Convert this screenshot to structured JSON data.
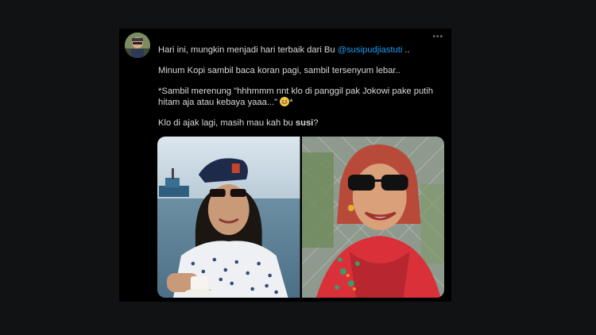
{
  "tweet": {
    "line1_prefix": "Hari ini, mungkin menjadi hari terbaik dari Bu ",
    "line1_mention": "@susipudjiastuti",
    "line1_suffix": " ..",
    "line2": "Minum Kopi sambil baca koran pagi,  sambil tersenyum lebar..",
    "line3": "*Sambil merenung \"hhhmmm nnt klo di panggil pak Jokowi pake putih hitam aja atau kebaya yaaa...\" ",
    "line3_end": "*",
    "line4_prefix": "Klo di ajak lagi, masih mau kah bu ",
    "line4_bold": "susi",
    "line4_suffix": "?",
    "more_icon": "•••"
  },
  "icons": {
    "more": "more-horizontal-icon",
    "emoji": "grinning-sweat-emoji-icon"
  },
  "colors": {
    "background": "#111214",
    "card": "#000000",
    "text": "#d9d9d9",
    "mention": "#1d9bf0"
  }
}
